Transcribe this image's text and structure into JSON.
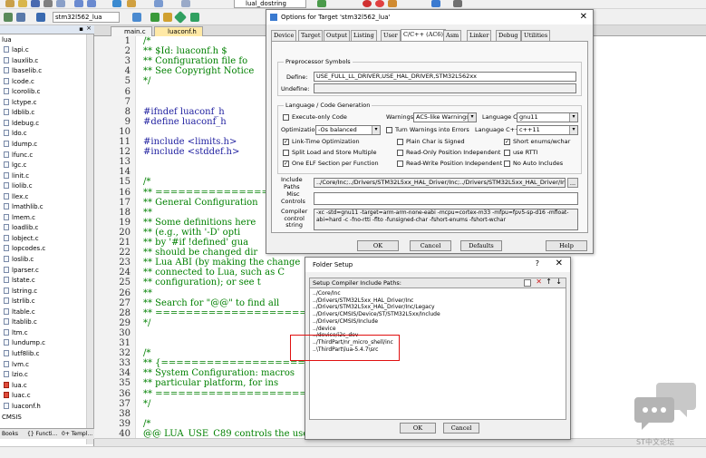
{
  "toolbar": {
    "target_select": "stm32l562_lua",
    "func_select": "lual_dostring"
  },
  "project": {
    "root": "lua",
    "files": [
      "lapi.c",
      "lauxlib.c",
      "lbaselib.c",
      "lcode.c",
      "lcorolib.c",
      "lctype.c",
      "ldblib.c",
      "ldebug.c",
      "ldo.c",
      "ldump.c",
      "lfunc.c",
      "lgc.c",
      "linit.c",
      "liolib.c",
      "llex.c",
      "lmathlib.c",
      "lmem.c",
      "loadlib.c",
      "lobject.c",
      "lopcodes.c",
      "loslib.c",
      "lparser.c",
      "lstate.c",
      "lstring.c",
      "lstrlib.c",
      "ltable.c",
      "ltablib.c",
      "ltm.c",
      "lundump.c",
      "lutf8lib.c",
      "lvm.c",
      "lzio.c",
      "lua.c",
      "luac.c",
      "luaconf.h"
    ],
    "group": "CMSIS",
    "tabs": [
      "Books",
      "{} Functi...",
      "0+ Templ..."
    ]
  },
  "editor": {
    "tabs": [
      "main.c",
      "luaconf.h"
    ],
    "lines": [
      {
        "n": "1",
        "t": "/*"
      },
      {
        "n": "2",
        "t": "** $Id: luaconf.h $"
      },
      {
        "n": "3",
        "t": "** Configuration file fo"
      },
      {
        "n": "4",
        "t": "** See Copyright Notice "
      },
      {
        "n": "5",
        "t": "*/"
      },
      {
        "n": "6",
        "t": ""
      },
      {
        "n": "7",
        "t": ""
      },
      {
        "n": "8",
        "t": "#ifndef luaconf_h"
      },
      {
        "n": "9",
        "t": "#define luaconf_h"
      },
      {
        "n": "10",
        "t": ""
      },
      {
        "n": "11",
        "t": "#include <limits.h>"
      },
      {
        "n": "12",
        "t": "#include <stddef.h>"
      },
      {
        "n": "13",
        "t": ""
      },
      {
        "n": "14",
        "t": ""
      },
      {
        "n": "15",
        "t": "/*"
      },
      {
        "n": "16",
        "t": "** ==================="
      },
      {
        "n": "17",
        "t": "** General Configuration"
      },
      {
        "n": "18",
        "t": "**"
      },
      {
        "n": "19",
        "t": "** Some definitions here"
      },
      {
        "n": "20",
        "t": "** (e.g., with '-D' opti"
      },
      {
        "n": "21",
        "t": "** by '#if !defined' gua"
      },
      {
        "n": "22",
        "t": "** should be changed dir"
      },
      {
        "n": "23",
        "t": "** Lua ABI (by making the change"
      },
      {
        "n": "24",
        "t": "** connected to Lua, such as C"
      },
      {
        "n": "25",
        "t": "** configuration); or see t"
      },
      {
        "n": "26",
        "t": "**"
      },
      {
        "n": "27",
        "t": "** Search for \"@@\" to find all"
      },
      {
        "n": "28",
        "t": "** ====================="
      },
      {
        "n": "29",
        "t": "*/"
      },
      {
        "n": "30",
        "t": ""
      },
      {
        "n": "31",
        "t": ""
      },
      {
        "n": "32",
        "t": "/*"
      },
      {
        "n": "33",
        "t": "** {===================="
      },
      {
        "n": "34",
        "t": "** System Configuration: macros"
      },
      {
        "n": "35",
        "t": "** particular platform, for ins"
      },
      {
        "n": "36",
        "t": "** ======================"
      },
      {
        "n": "37",
        "t": "*/"
      },
      {
        "n": "38",
        "t": ""
      },
      {
        "n": "39",
        "t": "/*"
      },
      {
        "n": "40",
        "t": "@@ LUA_USE_C89 controls the use"
      }
    ]
  },
  "options_dialog": {
    "title": "Options for Target 'stm32l562_lua'",
    "tabs": [
      "Device",
      "Target",
      "Output",
      "Listing",
      "User",
      "C/C++ (AC6)",
      "Asm",
      "Linker",
      "Debug",
      "Utilities"
    ],
    "preprocessor": {
      "legend": "Preprocessor Symbols",
      "define_label": "Define:",
      "define_value": "USE_FULL_LL_DRIVER,USE_HAL_DRIVER,STM32L562xx",
      "undefine_label": "Undefine:"
    },
    "codegen": {
      "legend": "Language / Code Generation",
      "execute_only": "Execute-only Code",
      "warnings_label": "Warnings:",
      "warnings_value": "AC5-like Warnings",
      "language_c_label": "Language C:",
      "language_c_value": "gnu11",
      "optimization_label": "Optimization:",
      "optimization_value": "-Os balanced",
      "turn_warnings": "Turn Warnings into Errors",
      "language_cpp_label": "Language C++:",
      "language_cpp_value": "c++11",
      "link_time": "Link-Time Optimization",
      "plain_char": "Plain Char is Signed",
      "short_enums": "Short enums/wchar",
      "split_load": "Split Load and Store Multiple",
      "read_only_pi": "Read-Only Position Independent",
      "use_rtti": "use RTTI",
      "one_elf": "One ELF Section per Function",
      "read_write_pi": "Read-Write Position Independent",
      "no_auto": "No Auto Includes"
    },
    "include_label": "Include\nPaths",
    "include_value": "../Core/Inc;../Drivers/STM32L5xx_HAL_Driver/Inc;../Drivers/STM32L5xx_HAL_Driver/Inc/Legacy;",
    "misc_label": "Misc\nControls",
    "compiler_label": "Compiler\ncontrol\nstring",
    "compiler_value": "-xc -std=gnu11 -target=arm-arm-none-eabi -mcpu=cortex-m33 -mfpu=fpv5-sp-d16 -mfloat-abi=hard -c -fno-rtti -flto -funsigned-char -fshort-enums -fshort-wchar",
    "buttons": {
      "ok": "OK",
      "cancel": "Cancel",
      "defaults": "Defaults",
      "help": "Help"
    }
  },
  "folder_dialog": {
    "title": "Folder Setup",
    "help": "?",
    "header": "Setup Compiler Include Paths:",
    "paths": [
      "../Core/Inc",
      "../Drivers/STM32L5xx_HAL_Driver/Inc",
      "../Drivers/STM32L5xx_HAL_Driver/Inc/Legacy",
      "../Drivers/CMSIS/Device/ST/STM32L5xx/Include",
      "../Drivers/CMSIS/Include",
      "../device",
      "../device/i2c_dev",
      "../ThirdPart/nr_micro_shell/inc",
      "..\\ThirdPart\\lua-5.4.7\\src"
    ],
    "buttons": {
      "ok": "OK",
      "cancel": "Cancel"
    }
  },
  "watermark": {
    "text": "ST中文论坛"
  }
}
